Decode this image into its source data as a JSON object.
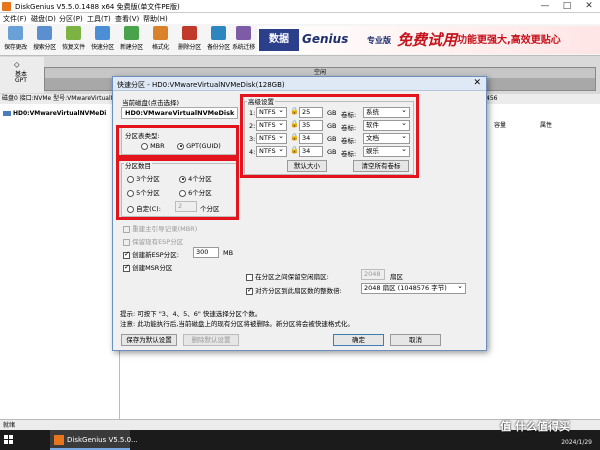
{
  "window": {
    "title": "DiskGenius V5.5.0.1488 x64 免费版(单文件PE版)",
    "controls": [
      "—",
      "□",
      "✕"
    ]
  },
  "menu": [
    "文件(F)",
    "磁盘(D)",
    "分区(P)",
    "工具(T)",
    "查看(V)",
    "帮助(H)"
  ],
  "toolbar": [
    {
      "label": "保存更改",
      "icon": "save-icon",
      "color": "#6aa0d8"
    },
    {
      "label": "搜索分区",
      "icon": "search-icon",
      "color": "#5b8fd0"
    },
    {
      "label": "恢复文件",
      "icon": "restore-icon",
      "color": "#7cb342"
    },
    {
      "label": "快速分区",
      "icon": "quick-partition-icon",
      "color": "#4a8fd6"
    },
    {
      "label": "新建分区",
      "icon": "new-partition-icon",
      "color": "#49a34b"
    },
    {
      "label": "格式化",
      "icon": "format-icon",
      "color": "#d9822b"
    },
    {
      "label": "删除分区",
      "icon": "delete-partition-icon",
      "color": "#c0392b"
    },
    {
      "label": "备份分区",
      "icon": "backup-icon",
      "color": "#2e86c1"
    },
    {
      "label": "系统迁移",
      "icon": "migrate-icon",
      "color": "#7d5ba6"
    }
  ],
  "banner": {
    "logo_text": "数据",
    "brand": "Genius",
    "tag": "专业版",
    "promo": "免费试用",
    "slogan": "功能更强大,高效更贴心"
  },
  "disk_panel": {
    "line1": "基本",
    "line2": "GPT"
  },
  "disk_map": {
    "free_label": "空闲"
  },
  "info_bar": "磁盘0 接口:NVMe  型号:VMwareVirtualNVMe",
  "info_bar_right": "456",
  "tree": {
    "item": "HD0:VMwareVirtualNVMeDi"
  },
  "columns": [
    "容量",
    "属性"
  ],
  "status": "就绪",
  "taskbar": {
    "app": "DiskGenius V5.5.0...",
    "date": "2024/1/29"
  },
  "watermark": "值 什么值得买",
  "dialog": {
    "title": "快速分区 - HD0:VMwareVirtualNVMeDisk(128GB)",
    "close": "✕",
    "current_disk_label": "当前磁盘(点击选择)",
    "current_disk_value": "HD0:VMwareVirtualNVMeDisk",
    "partition_type": {
      "label": "分区表类型:",
      "options": [
        {
          "label": "MBR",
          "selected": false
        },
        {
          "label": "GPT(GUID)",
          "selected": true
        }
      ]
    },
    "partition_count": {
      "label": "分区数目",
      "options": [
        {
          "label": "3个分区",
          "selected": false
        },
        {
          "label": "4个分区",
          "selected": true
        },
        {
          "label": "5个分区",
          "selected": false
        },
        {
          "label": "6个分区",
          "selected": false
        }
      ],
      "custom_label": "自定(C):",
      "custom_value": "2",
      "custom_suffix": "个分区"
    },
    "options": {
      "rebuild_mbr": "重建主引导记录(MBR)",
      "keep_esp": "保留现有ESP分区",
      "create_esp": "创建新ESP分区:",
      "esp_size": "300",
      "esp_unit": "MB",
      "create_msr": "创建MSR分区"
    },
    "advanced": {
      "label": "高级设置",
      "rows": [
        {
          "num": "1:",
          "fs": "NTFS",
          "size": "25",
          "unit": "GB",
          "vol_label": "卷标:",
          "name": "系统"
        },
        {
          "num": "2:",
          "fs": "NTFS",
          "size": "35",
          "unit": "GB",
          "vol_label": "卷标:",
          "name": "软件"
        },
        {
          "num": "3:",
          "fs": "NTFS",
          "size": "34",
          "unit": "GB",
          "vol_label": "卷标:",
          "name": "文档"
        },
        {
          "num": "4:",
          "fs": "NTFS",
          "size": "34",
          "unit": "GB",
          "vol_label": "卷标:",
          "name": "娱乐"
        }
      ],
      "default_size_btn": "默认大小",
      "clear_labels_btn": "清空所有卷标"
    },
    "free_space": {
      "label": "在分区之间保留空闲扇区:",
      "value": "2048",
      "unit": "扇区"
    },
    "align": {
      "label": "对齐分区到此扇区数的整数倍:",
      "value": "2048 扇区 (1048576 字节)"
    },
    "hint1": "提示: 可按下 \"3、4、5、6\" 快速选择分区个数。",
    "hint2": "注意: 此功能执行后,当前磁盘上的现有分区将被删除。新分区将会被快速格式化。",
    "buttons": {
      "save_default": "保存为默认设置",
      "delete_default": "删除默认设置",
      "ok": "确定",
      "cancel": "取消"
    }
  },
  "highlight_color": "#e3141c"
}
